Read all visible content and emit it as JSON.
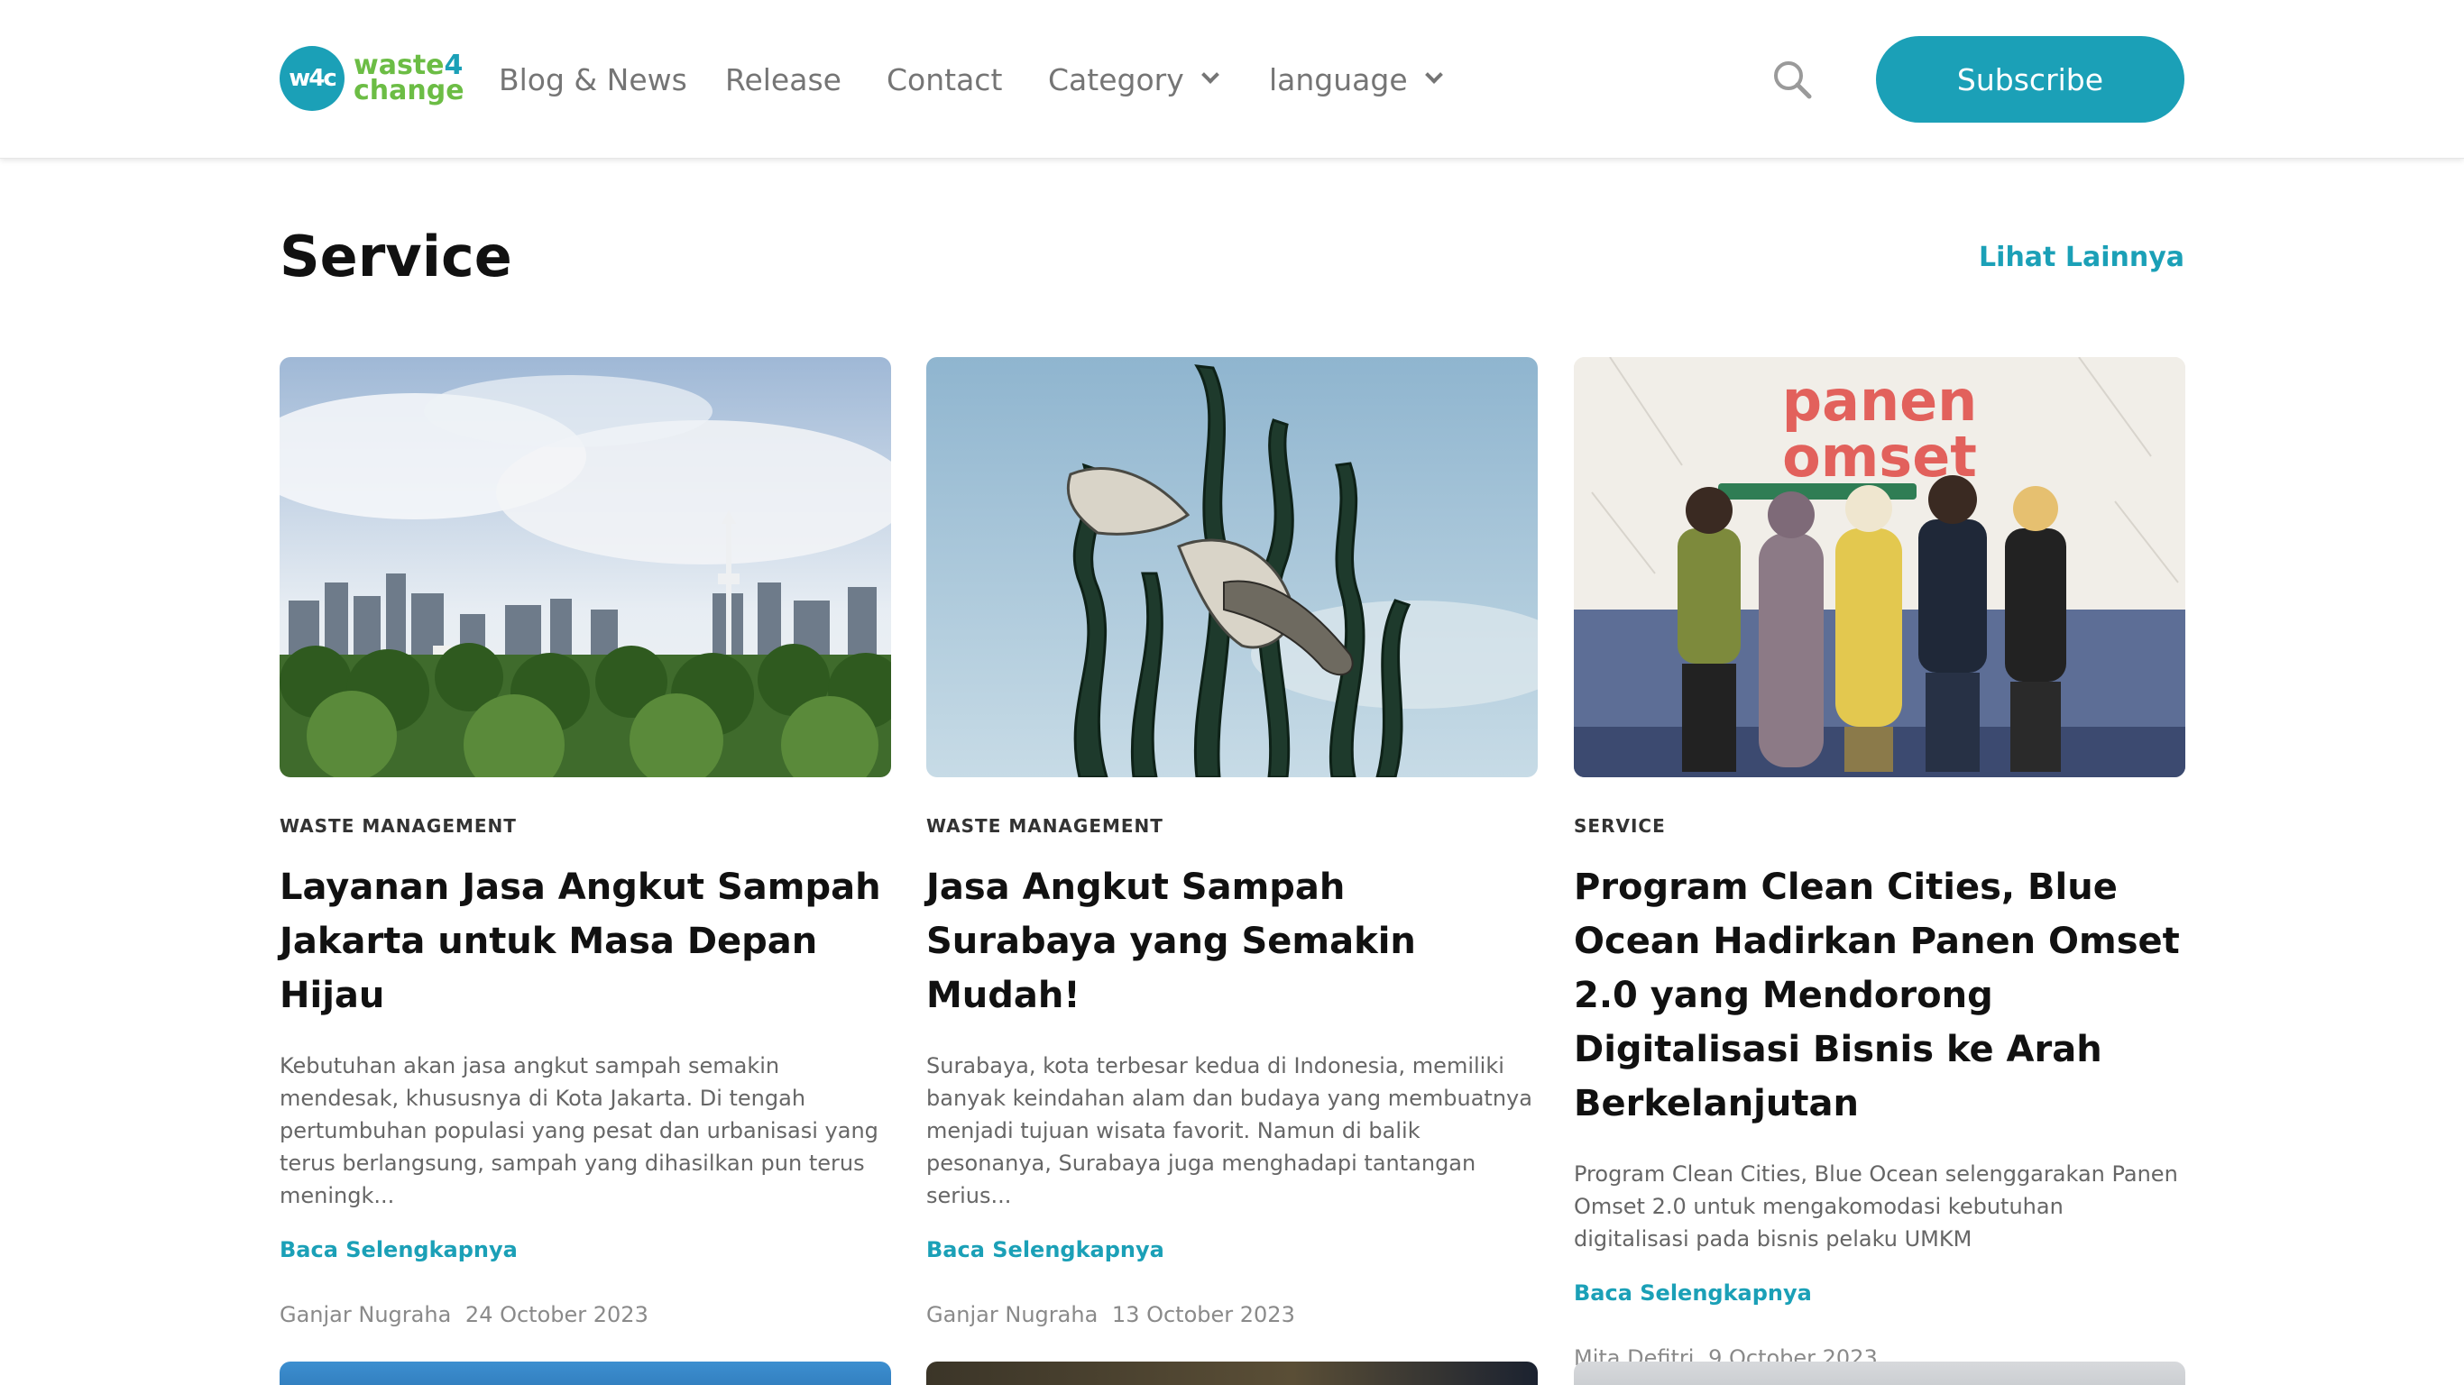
{
  "header": {
    "logo": {
      "line1": "waste",
      "line1_num": "4",
      "line2": "change",
      "mark": "w4c"
    },
    "nav": [
      {
        "label": "Blog & News",
        "dropdown": false
      },
      {
        "label": "Release",
        "dropdown": false
      },
      {
        "label": "Contact",
        "dropdown": false
      },
      {
        "label": "Category",
        "dropdown": true
      },
      {
        "label": "language",
        "dropdown": true
      }
    ],
    "search_icon": "search-icon",
    "subscribe_label": "Subscribe"
  },
  "section": {
    "title": "Service",
    "see_more": "Lihat Lainnya"
  },
  "cards": [
    {
      "category": "WASTE MANAGEMENT",
      "title": "Layanan Jasa Angkut Sampah Jakarta untuk Masa Depan Hijau",
      "excerpt": "Kebutuhan akan jasa angkut sampah semakin mendesak, khususnya di Kota Jakarta. Di tengah pertumbuhan populasi yang pesat dan urbanisasi yang terus berlangsung, sampah yang dihasilkan pun terus meningk...",
      "read_more": "Baca Selengkapnya",
      "author": "Ganjar Nugraha",
      "date": "24 October 2023"
    },
    {
      "category": "WASTE MANAGEMENT",
      "title": "Jasa Angkut Sampah Surabaya yang Semakin Mudah!",
      "excerpt": "Surabaya, kota terbesar kedua di Indonesia, memiliki banyak keindahan alam dan budaya yang membuatnya menjadi tujuan wisata favorit. Namun di balik pesonanya, Surabaya juga menghadapi tantangan serius...",
      "read_more": "Baca Selengkapnya",
      "author": "Ganjar Nugraha",
      "date": "13 October 2023"
    },
    {
      "category": "SERVICE",
      "title": "Program Clean Cities, Blue Ocean Hadirkan Panen Omset 2.0 yang Mendorong Digitalisasi Bisnis ke Arah Berkelanjutan",
      "excerpt": "Program Clean Cities, Blue Ocean selenggarakan Panen Omset 2.0 untuk mengakomodasi kebutuhan digitalisasi pada bisnis pelaku UMKM",
      "read_more": "Baca Selengkapnya",
      "author": "Mita Defitri",
      "date": "9 October 2023"
    }
  ],
  "banner_text": {
    "line1": "panen",
    "line2": "omset"
  },
  "colors": {
    "accent": "#1ba0b7",
    "brand_green": "#6cbd45",
    "text": "#111111",
    "muted": "#666666"
  }
}
